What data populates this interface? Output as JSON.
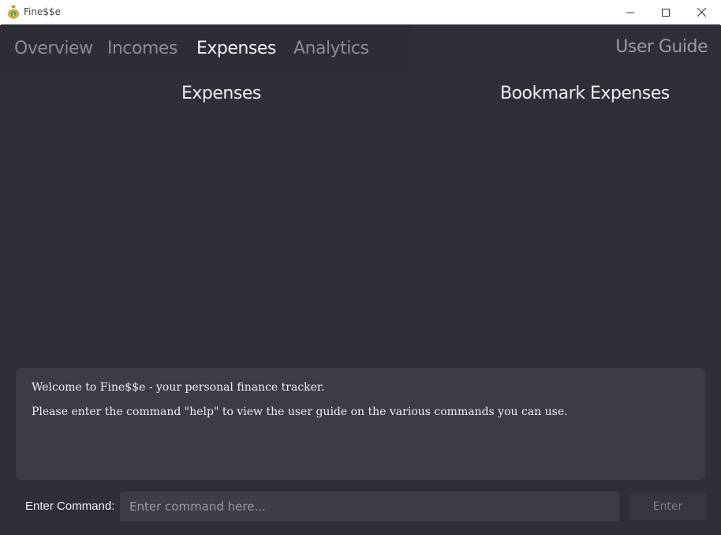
{
  "window": {
    "title": "Fine$$e",
    "controls": [
      "minimize-icon",
      "maximize-icon",
      "close-icon"
    ]
  },
  "tabs": [
    {
      "label": "Overview",
      "active": false
    },
    {
      "label": "Incomes",
      "active": false
    },
    {
      "label": "Expenses",
      "active": true
    },
    {
      "label": "Analytics",
      "active": false
    }
  ],
  "header": {
    "user_guide": "User Guide"
  },
  "panels": {
    "left_title": "Expenses",
    "right_title": "Bookmark Expenses"
  },
  "result": {
    "line1": "Welcome to Fine$$e - your personal finance tracker.",
    "line2": "Please enter the command \"help\" to view the user guide on the various commands you can use."
  },
  "command": {
    "label": "Enter Command:",
    "placeholder": "Enter command here...",
    "value": "",
    "button": "Enter"
  },
  "colors": {
    "background": "#2f2f37",
    "active_tab": "#f2f2f2",
    "inactive_tab": "#8c8c90",
    "result_box": "#3c3c45"
  }
}
